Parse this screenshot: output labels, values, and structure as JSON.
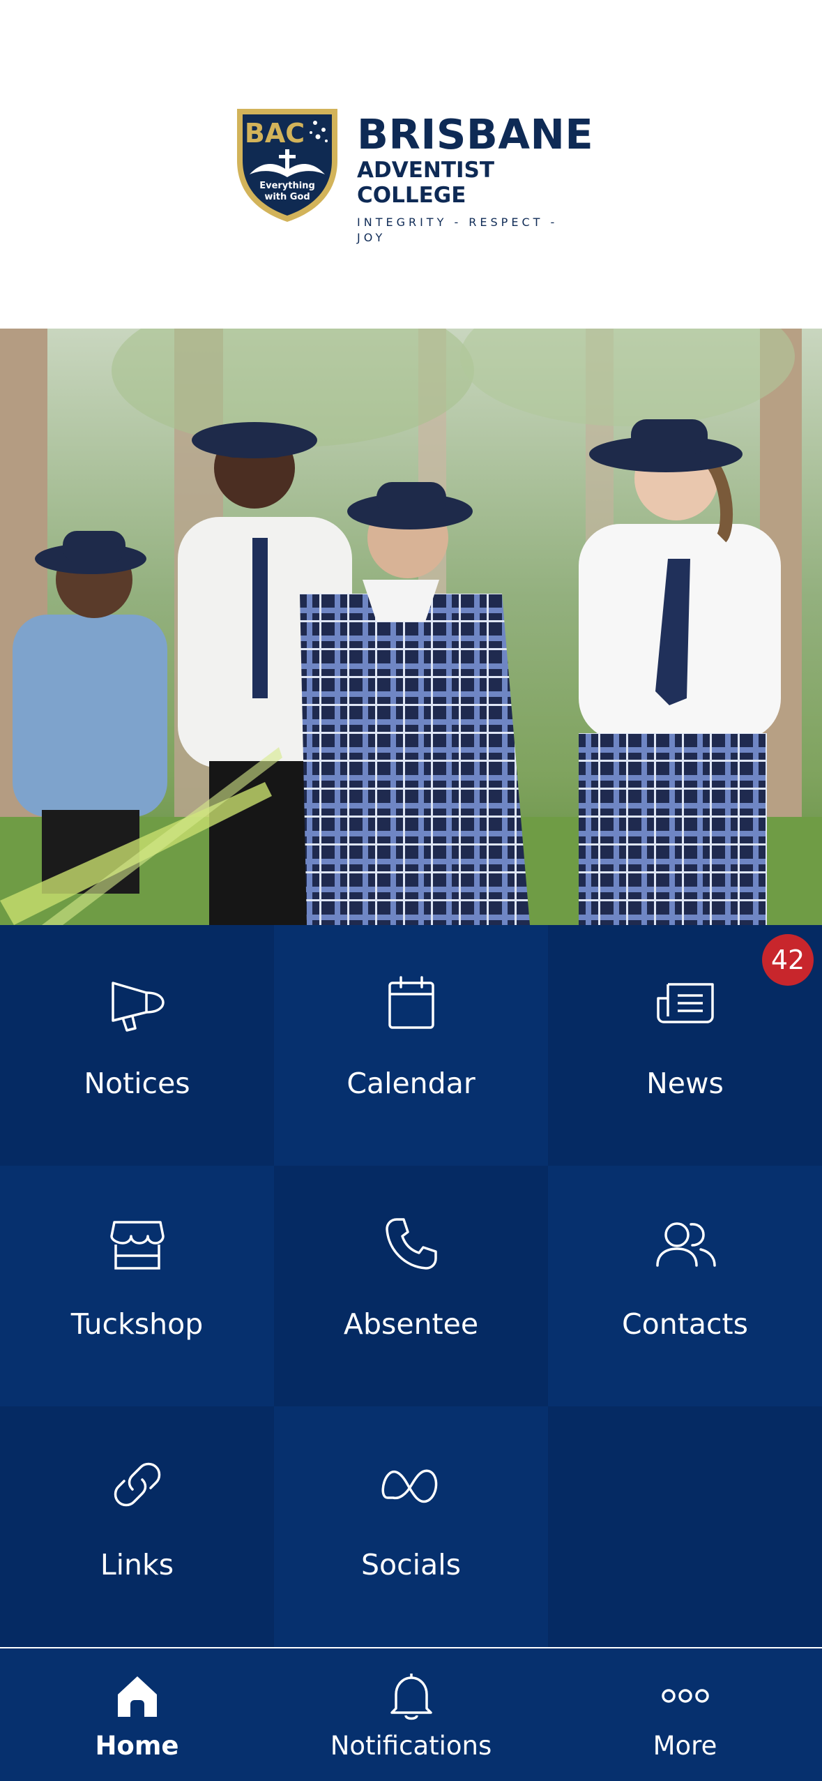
{
  "header": {
    "crest_text": "BAC",
    "crest_motto": "Everything with God",
    "brand_line1": "BRISBANE",
    "brand_line2": "ADVENTIST COLLEGE",
    "brand_tagline": "INTEGRITY - RESPECT - JOY"
  },
  "hero": {
    "image_alt": "Students in school uniform walking outdoors"
  },
  "tiles": [
    {
      "label": "Notices",
      "icon": "megaphone-icon"
    },
    {
      "label": "Calendar",
      "icon": "calendar-icon"
    },
    {
      "label": "News",
      "icon": "newspaper-icon",
      "badge": "42"
    },
    {
      "label": "Tuckshop",
      "icon": "shop-icon"
    },
    {
      "label": "Absentee",
      "icon": "phone-icon"
    },
    {
      "label": "Contacts",
      "icon": "people-icon"
    },
    {
      "label": "Links",
      "icon": "link-icon"
    },
    {
      "label": "Socials",
      "icon": "meta-icon"
    },
    {
      "label": "",
      "icon": ""
    }
  ],
  "tabbar": {
    "items": [
      {
        "label": "Home",
        "icon": "home-icon",
        "active": true
      },
      {
        "label": "Notifications",
        "icon": "bell-icon",
        "active": false
      },
      {
        "label": "More",
        "icon": "more-dots-icon",
        "active": false
      }
    ]
  },
  "colors": {
    "brand_navy": "#0e2a55",
    "tile_dark": "#052a63",
    "tile_light": "#06306e",
    "badge": "#c8262c",
    "crest_gold": "#d2b35a"
  }
}
